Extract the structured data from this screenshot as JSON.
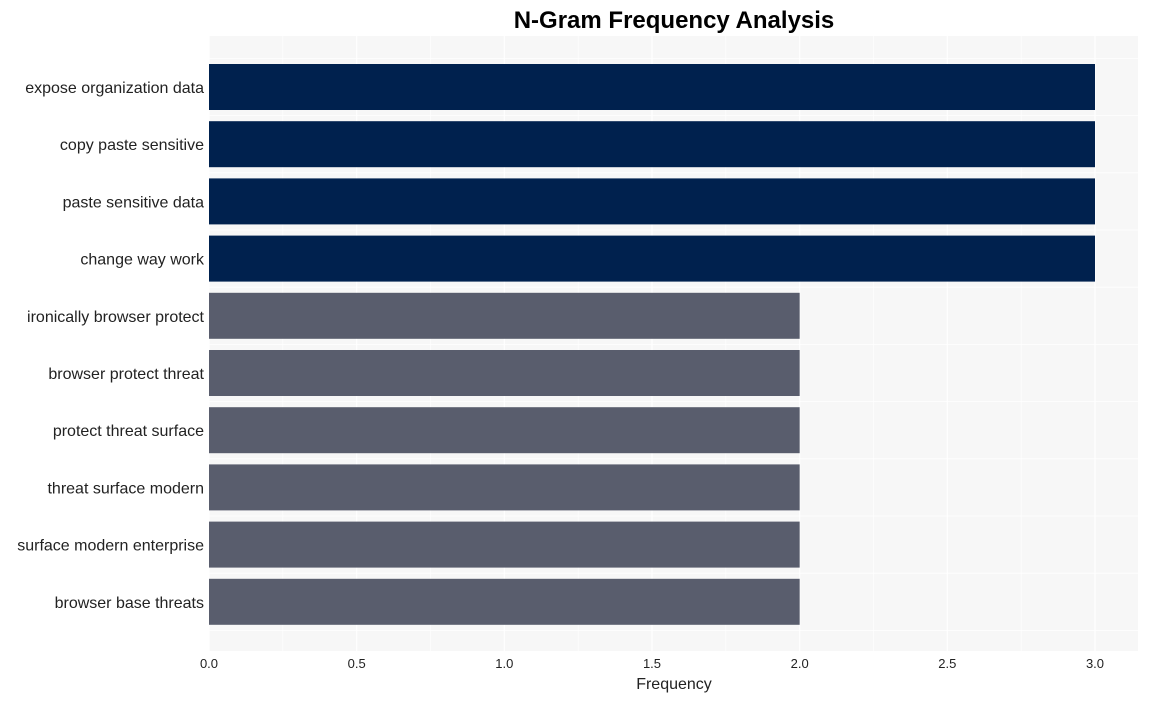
{
  "chart_data": {
    "type": "bar",
    "orientation": "horizontal",
    "title": "N-Gram Frequency Analysis",
    "xlabel": "Frequency",
    "ylabel": "",
    "xlim": [
      0,
      3.15
    ],
    "xticks": [
      "0.0",
      "0.5",
      "1.0",
      "1.5",
      "2.0",
      "2.5",
      "3.0"
    ],
    "xtick_values": [
      0,
      0.5,
      1.0,
      1.5,
      2.0,
      2.5,
      3.0
    ],
    "grid": true,
    "categories": [
      "expose organization data",
      "copy paste sensitive",
      "paste sensitive data",
      "change way work",
      "ironically browser protect",
      "browser protect threat",
      "protect threat surface",
      "threat surface modern",
      "surface modern enterprise",
      "browser base threats"
    ],
    "values": [
      3,
      3,
      3,
      3,
      2,
      2,
      2,
      2,
      2,
      2
    ],
    "colors": {
      "top": "#00214e",
      "other": "#595d6d",
      "plot_background": "#f7f7f7",
      "grid": "#ffffff"
    }
  }
}
